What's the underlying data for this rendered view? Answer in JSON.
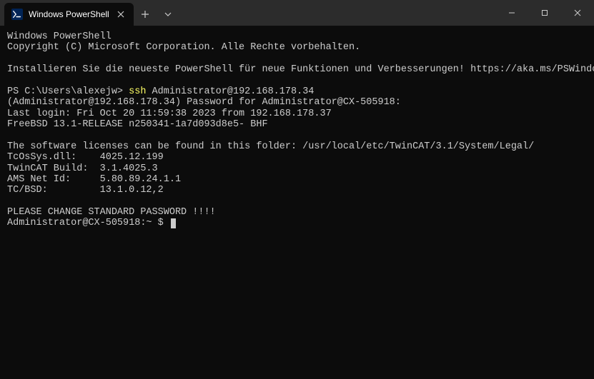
{
  "titlebar": {
    "tab_title": "Windows PowerShell",
    "tab_icon": "powershell-icon"
  },
  "terminal": {
    "header_line1": "Windows PowerShell",
    "header_line2": "Copyright (C) Microsoft Corporation. Alle Rechte vorbehalten.",
    "install_hint": "Installieren Sie die neueste PowerShell für neue Funktionen und Verbesserungen! https://aka.ms/PSWindows",
    "prompt1_prefix": "PS C:\\Users\\alexejw> ",
    "prompt1_cmd": "ssh",
    "prompt1_args": " Administrator@192.168.178.34",
    "pw_prompt": "(Administrator@192.168.178.34) Password for Administrator@CX-505918:",
    "last_login": "Last login: Fri Oct 20 11:59:38 2023 from 192.168.178.37",
    "freebsd": "FreeBSD 13.1-RELEASE n250341-1a7d093d8e5- BHF",
    "license_line": "The software licenses can be found in this folder: /usr/local/etc/TwinCAT/3.1/System/Legal/",
    "info_tcossys": "TcOsSys.dll:    4025.12.199",
    "info_build": "TwinCAT Build:  3.1.4025.3",
    "info_ams": "AMS Net Id:     5.80.89.24.1.1",
    "info_tcbsd": "TC/BSD:         13.1.0.12,2",
    "warn": "PLEASE CHANGE STANDARD PASSWORD !!!!",
    "prompt2": "Administrator@CX-505918:~ $ "
  }
}
